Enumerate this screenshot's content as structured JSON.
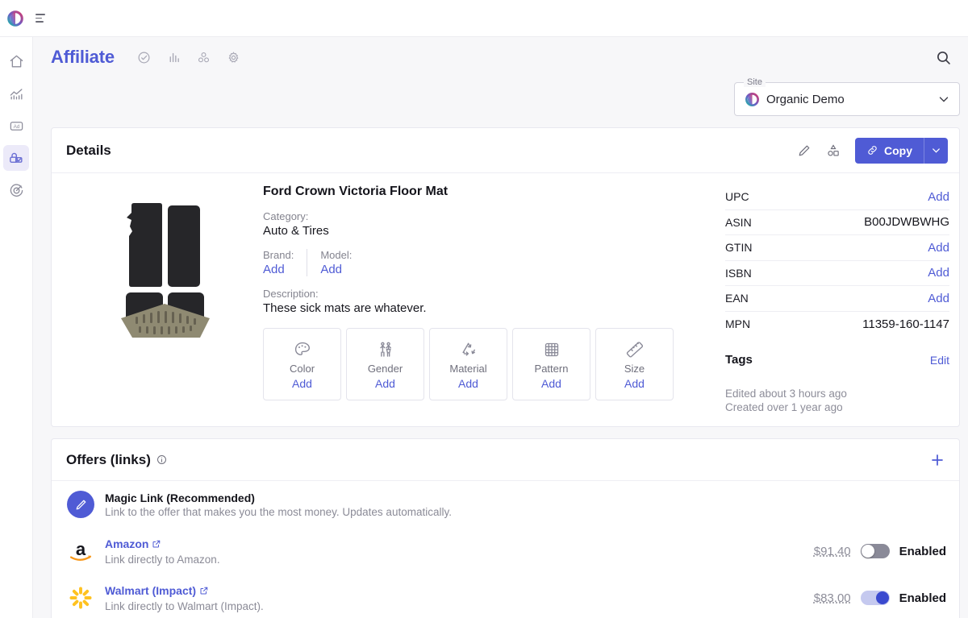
{
  "topbar": {
    "logo_icon": "organic-logo",
    "menu_icon": "hamburger-icon"
  },
  "rail": {
    "items": [
      {
        "name": "home",
        "icon": "home-icon",
        "active": false
      },
      {
        "name": "analytics",
        "icon": "chart-line-icon",
        "active": false
      },
      {
        "name": "ads",
        "icon": "ad-icon",
        "active": false
      },
      {
        "name": "affiliate",
        "icon": "affiliate-lock-icon",
        "active": true
      },
      {
        "name": "targets",
        "icon": "target-icon",
        "active": false
      }
    ]
  },
  "header": {
    "title": "Affiliate",
    "icons": [
      "check-circle-icon",
      "bar-chart-icon",
      "nodes-icon",
      "gear-icon"
    ],
    "search_icon": "search-icon"
  },
  "site": {
    "label": "Site",
    "value": "Organic Demo",
    "chevron_icon": "chevron-down-icon"
  },
  "details": {
    "title": "Details",
    "actions": {
      "edit_icon": "pencil-icon",
      "shapes_icon": "shapes-icon",
      "copy_label": "Copy",
      "copy_icon": "link-icon",
      "copy_caret_icon": "chevron-down-icon"
    },
    "product": {
      "name": "Ford Crown Victoria Floor Mat",
      "category_label": "Category:",
      "category_value": "Auto & Tires",
      "brand_label": "Brand:",
      "brand_value": "Add",
      "model_label": "Model:",
      "model_value": "Add",
      "description_label": "Description:",
      "description_value": "These sick mats are whatever.",
      "image_alt": "product-image-floor-mats"
    },
    "attributes": [
      {
        "name": "Color",
        "icon": "palette-icon",
        "action": "Add"
      },
      {
        "name": "Gender",
        "icon": "people-icon",
        "action": "Add"
      },
      {
        "name": "Material",
        "icon": "recycle-icon",
        "action": "Add"
      },
      {
        "name": "Pattern",
        "icon": "grid-icon",
        "action": "Add"
      },
      {
        "name": "Size",
        "icon": "ruler-icon",
        "action": "Add"
      }
    ],
    "identifiers": [
      {
        "key": "UPC",
        "value": "Add",
        "is_add": true
      },
      {
        "key": "ASIN",
        "value": "B00JDWBWHG",
        "is_add": false
      },
      {
        "key": "GTIN",
        "value": "Add",
        "is_add": true
      },
      {
        "key": "ISBN",
        "value": "Add",
        "is_add": true
      },
      {
        "key": "EAN",
        "value": "Add",
        "is_add": true
      },
      {
        "key": "MPN",
        "value": "11359-160-1147",
        "is_add": false
      }
    ],
    "tags": {
      "title": "Tags",
      "edit_label": "Edit"
    },
    "meta": {
      "edited": "Edited about 3 hours ago",
      "created": "Created over 1 year ago"
    }
  },
  "offers": {
    "title": "Offers (links)",
    "info_icon": "info-icon",
    "add_icon": "plus-icon",
    "rows": [
      {
        "icon": "magic-link-icon",
        "title": "Magic Link (Recommended)",
        "subtitle": "Link to the offer that makes you the most money. Updates automatically.",
        "is_link": false,
        "price": "",
        "toggle_state": "",
        "status": ""
      },
      {
        "icon": "amazon-icon",
        "title": "Amazon",
        "subtitle": "Link directly to Amazon.",
        "is_link": true,
        "price": "$91.40",
        "toggle_state": "off",
        "status": "Enabled"
      },
      {
        "icon": "walmart-icon",
        "title": "Walmart (Impact)",
        "subtitle": "Link directly to Walmart (Impact).",
        "is_link": true,
        "price": "$83.00",
        "toggle_state": "on",
        "status": "Enabled"
      }
    ]
  },
  "colors": {
    "accent": "#4f5bd5",
    "page_bg": "#f7f7f9",
    "card_bg": "#ffffff",
    "muted_text": "#8b8b97",
    "toggle_on": "#3a49cf",
    "amazon_orange": "#f8991d",
    "walmart_yellow": "#ffc220"
  }
}
